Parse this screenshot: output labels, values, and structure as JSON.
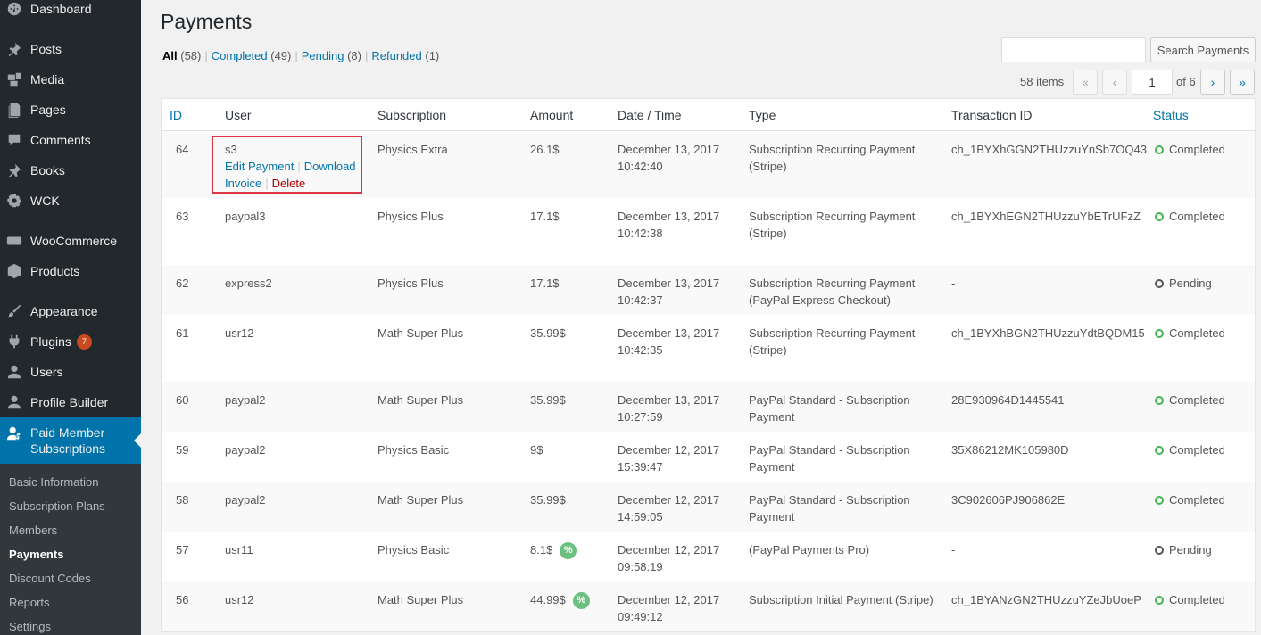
{
  "sidebar": {
    "items": [
      {
        "label": "Dashboard",
        "icon": "dashboard-icon"
      },
      {
        "label": "Posts",
        "icon": "pin-icon"
      },
      {
        "label": "Media",
        "icon": "media-icon"
      },
      {
        "label": "Pages",
        "icon": "pages-icon"
      },
      {
        "label": "Comments",
        "icon": "comment-icon"
      },
      {
        "label": "Books",
        "icon": "pin-icon"
      },
      {
        "label": "WCK",
        "icon": "gear-icon"
      },
      {
        "label": "WooCommerce",
        "icon": "woo-icon"
      },
      {
        "label": "Products",
        "icon": "box-icon"
      },
      {
        "label": "Appearance",
        "icon": "brush-icon"
      },
      {
        "label": "Plugins",
        "icon": "plugin-icon",
        "badge": "7"
      },
      {
        "label": "Users",
        "icon": "user-icon"
      },
      {
        "label": "Profile Builder",
        "icon": "user-icon"
      },
      {
        "label": "Paid Member Subscriptions",
        "icon": "member-icon"
      }
    ],
    "active_label_line1": "Paid Member",
    "active_label_line2": "Subscriptions",
    "submenu": [
      "Basic Information",
      "Subscription Plans",
      "Members",
      "Payments",
      "Discount Codes",
      "Reports",
      "Settings"
    ]
  },
  "page": {
    "title": "Payments",
    "views": [
      {
        "label": "All",
        "count": "(58)"
      },
      {
        "label": "Completed",
        "count": "(49)"
      },
      {
        "label": "Pending",
        "count": "(8)"
      },
      {
        "label": "Refunded",
        "count": "(1)"
      }
    ],
    "search_button": "Search Payments",
    "search_value": "",
    "items_count": "58 items",
    "pagination": {
      "first": "«",
      "prev": "‹",
      "current": "1",
      "of": "of 6",
      "next": "›",
      "last": "»"
    }
  },
  "table": {
    "columns": [
      "ID",
      "User",
      "Subscription",
      "Amount",
      "Date / Time",
      "Type",
      "Transaction ID",
      "Status"
    ],
    "row_actions": {
      "edit": "Edit Payment",
      "download": "Download",
      "invoice": "Invoice",
      "delete": "Delete"
    },
    "discount_icon": "%",
    "rows": [
      {
        "id": "64",
        "user": "s3",
        "subscription": "Physics Extra",
        "amount": "26.1$",
        "date": "December 13, 2017",
        "time": "10:42:40",
        "type1": "Subscription Recurring Payment",
        "type2": "(Stripe)",
        "txn": "ch_1BYXhGGN2THUzzuYnSb7OQ43",
        "status": "Completed"
      },
      {
        "id": "63",
        "user": "paypal3",
        "subscription": "Physics Plus",
        "amount": "17.1$",
        "date": "December 13, 2017",
        "time": "10:42:38",
        "type1": "Subscription Recurring Payment",
        "type2": "(Stripe)",
        "txn": "ch_1BYXhEGN2THUzzuYbETrUFzZ",
        "status": "Completed"
      },
      {
        "id": "62",
        "user": "express2",
        "subscription": "Physics Plus",
        "amount": "17.1$",
        "date": "December 13, 2017",
        "time": "10:42:37",
        "type1": "Subscription Recurring Payment",
        "type2": "(PayPal Express Checkout)",
        "txn": "-",
        "status": "Pending"
      },
      {
        "id": "61",
        "user": "usr12",
        "subscription": "Math Super Plus",
        "amount": "35.99$",
        "date": "December 13, 2017",
        "time": "10:42:35",
        "type1": "Subscription Recurring Payment",
        "type2": "(Stripe)",
        "txn": "ch_1BYXhBGN2THUzzuYdtBQDM15",
        "status": "Completed"
      },
      {
        "id": "60",
        "user": "paypal2",
        "subscription": "Math Super Plus",
        "amount": "35.99$",
        "date": "December 13, 2017",
        "time": "10:27:59",
        "type1": "PayPal Standard - Subscription",
        "type2": "Payment",
        "txn": "28E930964D1445541",
        "status": "Completed"
      },
      {
        "id": "59",
        "user": "paypal2",
        "subscription": "Physics Basic",
        "amount": "9$",
        "date": "December 12, 2017",
        "time": "15:39:47",
        "type1": "PayPal Standard - Subscription",
        "type2": "Payment",
        "txn": "35X86212MK105980D",
        "status": "Completed"
      },
      {
        "id": "58",
        "user": "paypal2",
        "subscription": "Math Super Plus",
        "amount": "35.99$",
        "date": "December 12, 2017",
        "time": "14:59:05",
        "type1": "PayPal Standard - Subscription",
        "type2": "Payment",
        "txn": "3C902606PJ906862E",
        "status": "Completed"
      },
      {
        "id": "57",
        "user": "usr11",
        "subscription": "Physics Basic",
        "amount": "8.1$",
        "date": "December 12, 2017",
        "time": "09:58:19",
        "type1": "(PayPal Payments Pro)",
        "type2": "",
        "txn": "-",
        "status": "Pending",
        "discount": true
      },
      {
        "id": "56",
        "user": "usr12",
        "subscription": "Math Super Plus",
        "amount": "44.99$",
        "date": "December 12, 2017",
        "time": "09:49:12",
        "type1": "Subscription Initial Payment (Stripe)",
        "type2": "",
        "txn": "ch_1BYANzGN2THUzzuYZeJbUoeP",
        "status": "Completed",
        "discount": true
      }
    ]
  }
}
